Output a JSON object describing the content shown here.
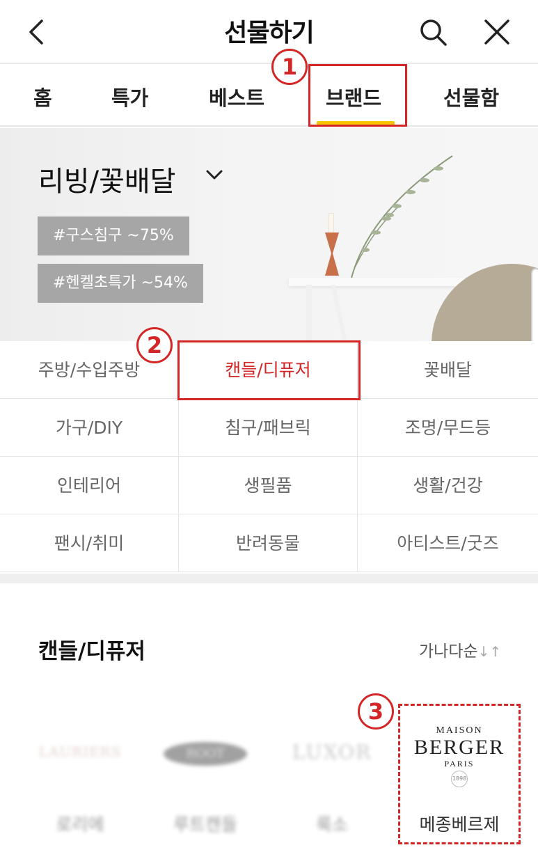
{
  "header": {
    "title": "선물하기",
    "back_icon": "chevron-left-icon",
    "search_icon": "search-icon",
    "close_icon": "close-icon"
  },
  "tabs": [
    {
      "label": "홈"
    },
    {
      "label": "특가"
    },
    {
      "label": "베스트"
    },
    {
      "label": "브랜드",
      "active": true
    },
    {
      "label": "선물함"
    }
  ],
  "annotations": [
    "1",
    "2",
    "3"
  ],
  "banner": {
    "title": "리빙/꽃배달",
    "tags": [
      "#구스침구 ~75%",
      "#헨켈초특가 ~54%"
    ]
  },
  "categories": [
    [
      "주방/수입주방",
      "캔들/디퓨저",
      "꽃배달"
    ],
    [
      "가구/DIY",
      "침구/패브릭",
      "조명/무드등"
    ],
    [
      "인테리어",
      "생필품",
      "생활/건강"
    ],
    [
      "팬시/취미",
      "반려동물",
      "아티스트/굿즈"
    ]
  ],
  "selected_category": "캔들/디퓨저",
  "section": {
    "title": "캔들/디퓨저",
    "sort_label": "가나다순",
    "sort_icon": "↓↑"
  },
  "brands": [
    {
      "name": "로리에",
      "logo_text": "LAURIERS"
    },
    {
      "name": "루트캔들",
      "logo_text": "ROOT"
    },
    {
      "name": "룩소",
      "logo_text": "LUXOR"
    },
    {
      "name": "메종베르제",
      "logo_lines": [
        "MAISON",
        "BERGER",
        "PARIS",
        "1898"
      ]
    }
  ],
  "colors": {
    "accent_red": "#d42626",
    "tab_underline": "#f7c500",
    "tag_bg": "#a6a6a6"
  }
}
